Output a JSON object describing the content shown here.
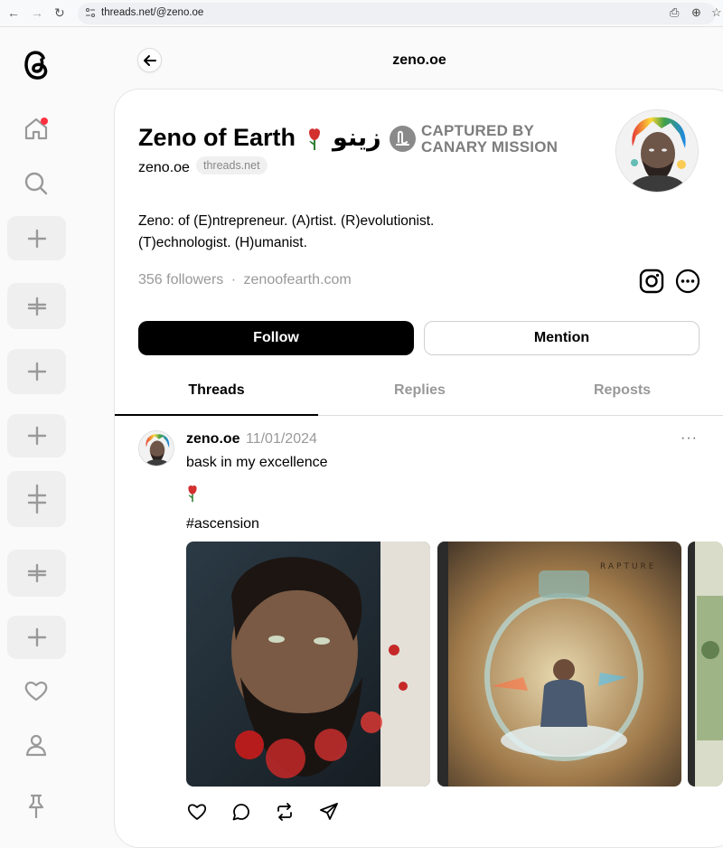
{
  "browser": {
    "url": "threads.net/@zeno.oe"
  },
  "header": {
    "title": "zeno.oe"
  },
  "profile": {
    "name": "Zeno of Earth",
    "name_arabic": "زينو",
    "captured_line1": "CAPTURED BY",
    "captured_line2": "CANARY MISSION",
    "handle": "zeno.oe",
    "domain_badge": "threads.net",
    "bio_line1": "Zeno: of (E)ntrepreneur. (A)rtist. (R)evolutionist.",
    "bio_line2": "(T)echnologist. (H)umanist.",
    "followers": "356 followers",
    "separator": "·",
    "website": "zenoofearth.com",
    "follow_label": "Follow",
    "mention_label": "Mention"
  },
  "tabs": [
    {
      "label": "Threads",
      "active": true
    },
    {
      "label": "Replies",
      "active": false
    },
    {
      "label": "Reposts",
      "active": false
    }
  ],
  "post": {
    "username": "zeno.oe",
    "date": "11/01/2024",
    "more": "···",
    "text": "bask in my excellence",
    "hashtag": "#ascension",
    "image2_caption": "RAPTURE"
  },
  "icons": {
    "sidebar": [
      "threads-logo",
      "home-icon",
      "search-icon",
      "plus-icon",
      "plus-icon",
      "plus-icon",
      "plus-icon",
      "plus-icon",
      "plus-icon",
      "plus-icon",
      "heart-icon",
      "profile-icon",
      "pin-icon"
    ],
    "actions": [
      "like-icon",
      "comment-icon",
      "repost-icon",
      "share-icon"
    ]
  },
  "colors": {
    "accent_red": "#ff3040",
    "follow_bg": "#000000",
    "muted_text": "#999999"
  }
}
